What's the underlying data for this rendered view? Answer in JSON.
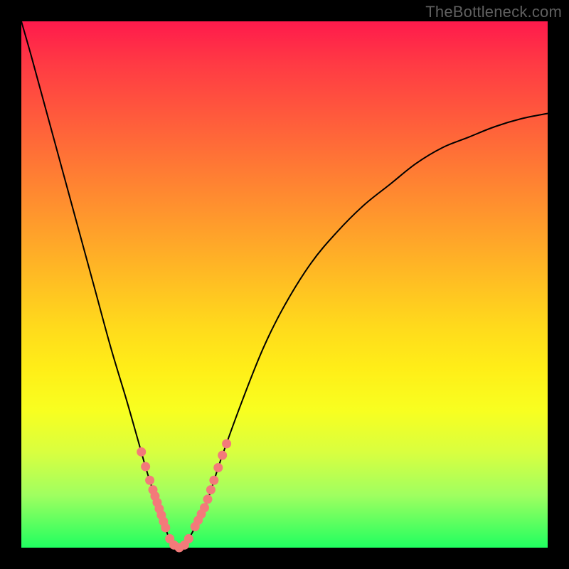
{
  "watermark": "TheBottleneck.com",
  "colors": {
    "background": "#000000",
    "curve": "#000000",
    "dots": "#f37a7a",
    "basin": "#15e060",
    "gradient_top": "#ff1a4c",
    "gradient_mid": "#ffda1c",
    "gradient_bottom": "#20ff60"
  },
  "chart_data": {
    "type": "line",
    "title": "",
    "xlabel": "",
    "ylabel": "",
    "xlim": [
      0,
      100
    ],
    "ylim": [
      0,
      100
    ],
    "series": [
      {
        "name": "bottleneck-curve",
        "x": [
          0,
          2,
          5,
          8,
          11,
          14,
          17,
          20,
          22,
          24,
          26,
          27,
          28,
          29,
          30,
          31,
          32,
          35,
          38,
          42,
          46,
          50,
          55,
          60,
          65,
          70,
          75,
          80,
          85,
          90,
          95,
          100
        ],
        "y": [
          100,
          93,
          82,
          71,
          60,
          49,
          38,
          28,
          21,
          14,
          8,
          5,
          2,
          0.5,
          0,
          0.5,
          2,
          8,
          17,
          28,
          38,
          46,
          54,
          60,
          65,
          69,
          73,
          76,
          78,
          80,
          81.5,
          82.5
        ]
      }
    ],
    "basin_x_range": [
      28,
      32
    ],
    "dots": {
      "left_branch_x": [
        22.8,
        23.6,
        24.4,
        25.0,
        25.4,
        25.8,
        26.2,
        26.6,
        27.0,
        27.4
      ],
      "right_branch_x": [
        33.0,
        33.6,
        34.2,
        34.8,
        35.4,
        36.0,
        36.6,
        37.4,
        38.2,
        39.0
      ]
    },
    "annotations": []
  }
}
